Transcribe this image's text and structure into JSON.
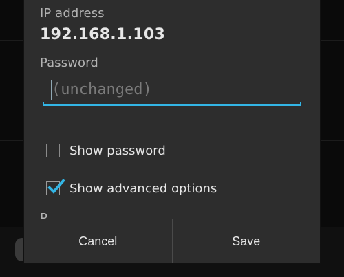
{
  "dialog": {
    "ip_label": "IP address",
    "ip_value": "192.168.1.103",
    "password_label": "Password",
    "password_placeholder": "(unchanged)",
    "show_password": {
      "label": "Show password",
      "checked": false
    },
    "show_advanced": {
      "label": "Show advanced options",
      "checked": true
    },
    "clipped_next_label": "P",
    "buttons": {
      "cancel": "Cancel",
      "save": "Save"
    }
  },
  "colors": {
    "dialog_bg": "#2d2d2d",
    "accent": "#33b5e5",
    "text_primary": "#e6e6e6",
    "text_secondary": "#b3b3b3",
    "placeholder": "#7a7a7a"
  },
  "icons": {
    "checkbox_checked": "checkmark-icon"
  }
}
